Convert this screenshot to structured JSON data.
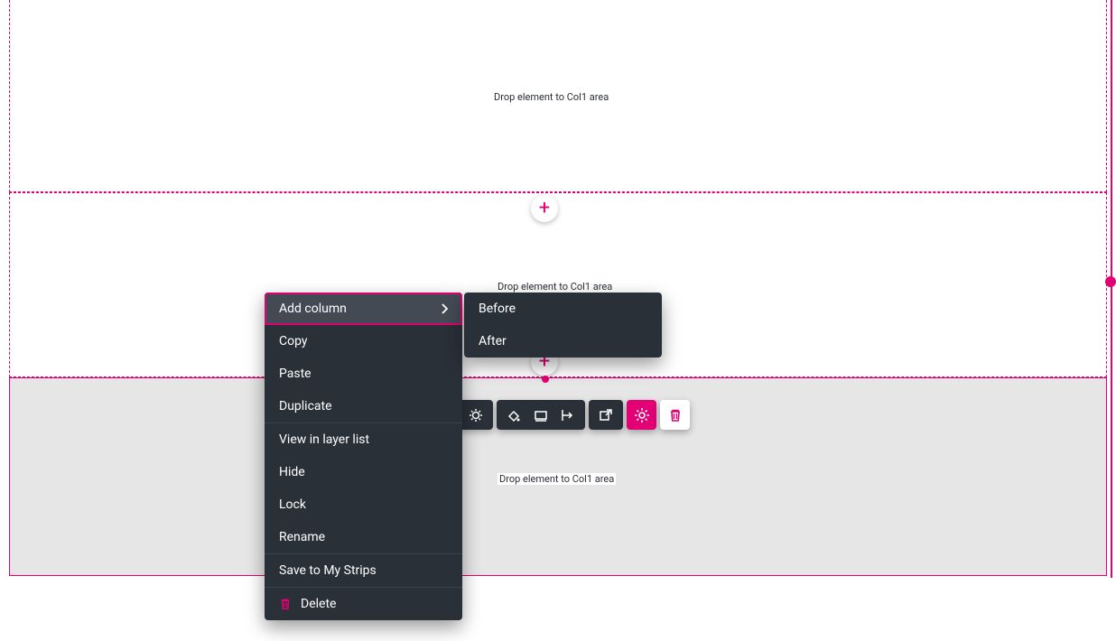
{
  "drop_text": "Drop element to Col1 area",
  "context_menu": {
    "add_column": "Add column",
    "copy": "Copy",
    "paste": "Paste",
    "duplicate": "Duplicate",
    "view_in_layer_list": "View in layer list",
    "hide": "Hide",
    "lock": "Lock",
    "rename": "Rename",
    "save_to_my_strips": "Save to My Strips",
    "delete": "Delete"
  },
  "submenu": {
    "before": "Before",
    "after": "After"
  },
  "colors": {
    "accent": "#e20074",
    "menu_bg": "#2a3038"
  }
}
